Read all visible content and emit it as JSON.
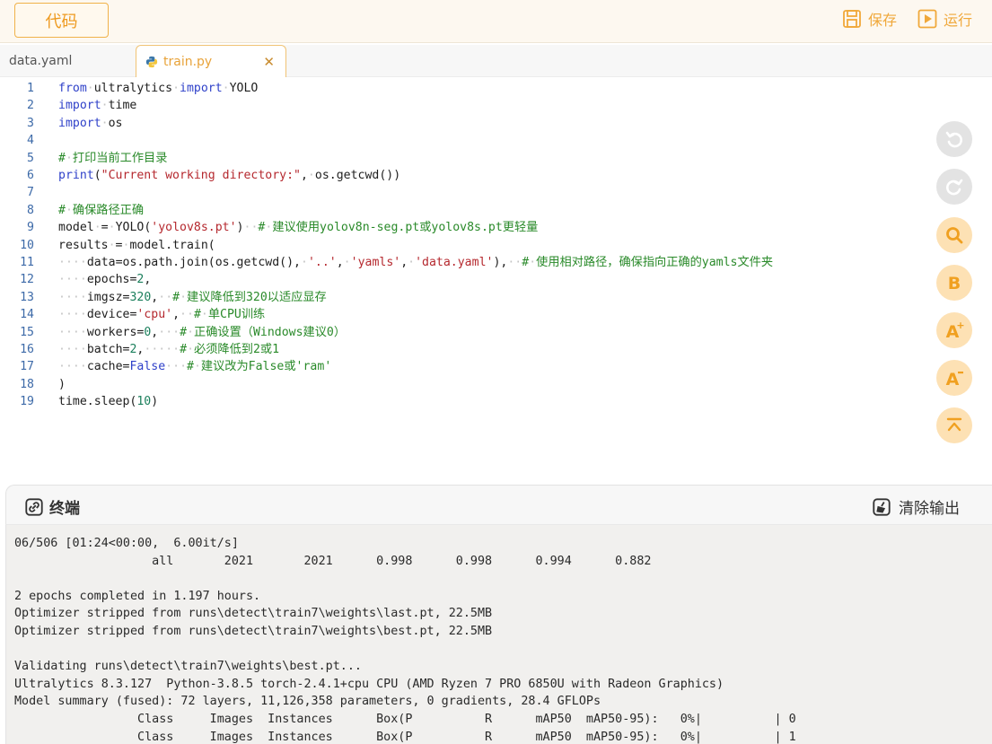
{
  "toolbar": {
    "code_label": "代码",
    "save_label": "保存",
    "run_label": "运行"
  },
  "tabs": [
    {
      "label": "data.yaml",
      "active": false
    },
    {
      "label": "train.py",
      "active": true
    }
  ],
  "editor": {
    "lines": [
      "from ultralytics import YOLO",
      "import time",
      "import os",
      "",
      "# 打印当前工作目录",
      "print(\"Current working directory:\", os.getcwd())",
      "",
      "# 确保路径正确",
      "model = YOLO('yolov8s.pt')  # 建议使用yolov8n-seg.pt或yolov8s.pt更轻量",
      "results = model.train(",
      "    data=os.path.join(os.getcwd(), '..', 'yamls', 'data.yaml'),  # 使用相对路径，确保指向正确的yamls文件夹",
      "    epochs=2,",
      "    imgsz=320,  # 建议降低到320以适应显存",
      "    device='cpu',  # 单CPU训练",
      "    workers=0,   # 正确设置（Windows建议0）",
      "    batch=2,     # 必须降低到2或1",
      "    cache=False   # 建议改为False或'ram'",
      ")",
      "time.sleep(10)"
    ]
  },
  "terminal": {
    "title": "终端",
    "clear_label": "清除输出",
    "lines": [
      "06/506 [01:24<00:00,  6.00it/s]",
      "                   all       2021       2021      0.998      0.998      0.994      0.882",
      "",
      "2 epochs completed in 1.197 hours.",
      "Optimizer stripped from runs\\detect\\train7\\weights\\last.pt, 22.5MB",
      "Optimizer stripped from runs\\detect\\train7\\weights\\best.pt, 22.5MB",
      "",
      "Validating runs\\detect\\train7\\weights\\best.pt...",
      "Ultralytics 8.3.127  Python-3.8.5 torch-2.4.1+cpu CPU (AMD Ryzen 7 PRO 6850U with Radeon Graphics)",
      "Model summary (fused): 72 layers, 11,126,358 parameters, 0 gradients, 28.4 GFLOPs",
      "                 Class     Images  Instances      Box(P          R      mAP50  mAP50-95):   0%|          | 0",
      "                 Class     Images  Instances      Box(P          R      mAP50  mAP50-95):   0%|          | 1"
    ]
  },
  "tools": [
    {
      "name": "undo-icon",
      "state": "disabled"
    },
    {
      "name": "redo-icon",
      "state": "disabled"
    },
    {
      "name": "search-icon",
      "state": "enabled"
    },
    {
      "name": "bold-b-icon",
      "state": "enabled"
    },
    {
      "name": "font-increase-icon",
      "state": "enabled"
    },
    {
      "name": "font-decrease-icon",
      "state": "enabled"
    },
    {
      "name": "scroll-top-icon",
      "state": "enabled"
    }
  ],
  "colors": {
    "accent": "#f0a83a",
    "keyword": "#2f41c9",
    "string": "#b5282e",
    "comment": "#2a8a2a",
    "number": "#1b7f5c"
  }
}
